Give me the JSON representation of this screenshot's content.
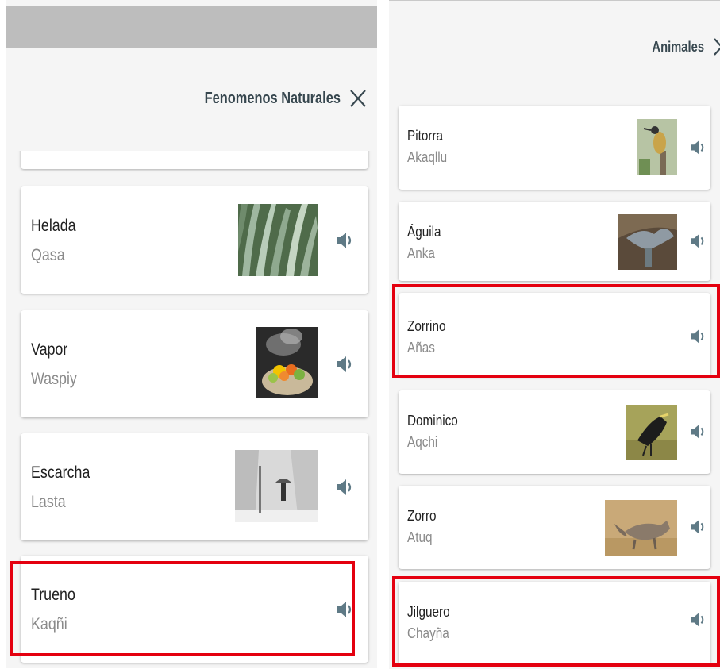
{
  "left_panel": {
    "title": "Fenomenos Naturales",
    "cards": [
      {
        "spanish": "Helada",
        "quechua": "Qasa",
        "thumbnail": "frosted-leaves"
      },
      {
        "spanish": "Vapor",
        "quechua": "Waspiy",
        "thumbnail": "steaming-vegetables"
      },
      {
        "spanish": "Escarcha",
        "quechua": "Lasta",
        "thumbnail": "snowy-street"
      },
      {
        "spanish": "Trueno",
        "quechua": "Kaqñi",
        "thumbnail": ""
      }
    ]
  },
  "right_panel": {
    "title": "Animales",
    "cards": [
      {
        "spanish": "Pitorra",
        "quechua": "Akaqllu",
        "thumbnail": "woodpecker"
      },
      {
        "spanish": "Águila",
        "quechua": "Anka",
        "thumbnail": "eagle"
      },
      {
        "spanish": "Zorrino",
        "quechua": "Añas",
        "thumbnail": ""
      },
      {
        "spanish": "Dominico",
        "quechua": "Aqchi",
        "thumbnail": "black-bird"
      },
      {
        "spanish": "Zorro",
        "quechua": "Atuq",
        "thumbnail": "fox"
      },
      {
        "spanish": "Jilguero",
        "quechua": "Chayña",
        "thumbnail": ""
      }
    ]
  },
  "icons": {
    "speaker": "volume-icon",
    "close": "close-icon"
  },
  "colors": {
    "highlight": "#e4000f",
    "icon": "#5f7a86",
    "header_text": "#37474f",
    "topbar": "#bdbdbd"
  }
}
